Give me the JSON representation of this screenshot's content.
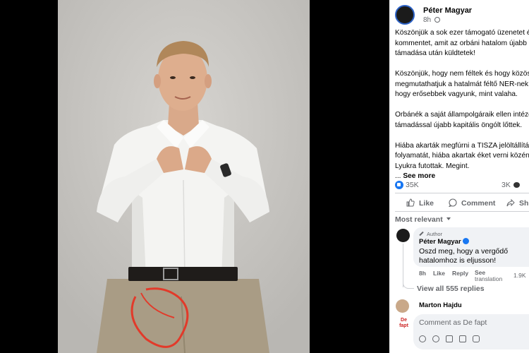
{
  "post": {
    "author": "Péter Magyar",
    "time": "8h",
    "paragraphs": [
      [
        "Köszönjük a sok ezer támogató üzenetet é",
        "kommentet, amit az orbáni hatalom újabb a",
        "támadása után küldtetek!"
      ],
      [
        "Köszönjük, hogy nem féltek és hogy közös",
        "megmutathatjuk a hatalmát féltő NER-nek,",
        "hogy erősebbek vagyunk, mint valaha."
      ],
      [
        "Orbánék a saját állampolgáraik ellen intéze",
        "támadással újabb kapitális öngólt lőttek."
      ],
      [
        "Hiába akarták megfúrni a TISZA jelöltállítás",
        "folyamatát, hiába akartak éket verni közénk",
        "Lyukra futottak. Megint."
      ]
    ],
    "see_more_prefix": "... ",
    "see_more": "See more"
  },
  "reactions": {
    "likes": "35K",
    "comments": "3K",
    "shares": "2"
  },
  "actions": {
    "like": "Like",
    "comment": "Comment",
    "share": "Sh"
  },
  "comments": {
    "sort_label": "Most relevant",
    "top": {
      "badge": "Author",
      "name": "Péter Magyar",
      "text_line1": "Oszd meg, hogy a vergődő",
      "text_line2": "hatalomhoz is eljusson!",
      "time": "8h",
      "like": "Like",
      "reply": "Reply",
      "see": "See",
      "translation": "translation",
      "reaction_count": "1.9K"
    },
    "view_replies": "View all 555 replies",
    "next_name": "Marton Hajdu",
    "input_placeholder": "Comment as De fapt",
    "input_avatar_text": "De fapt"
  }
}
